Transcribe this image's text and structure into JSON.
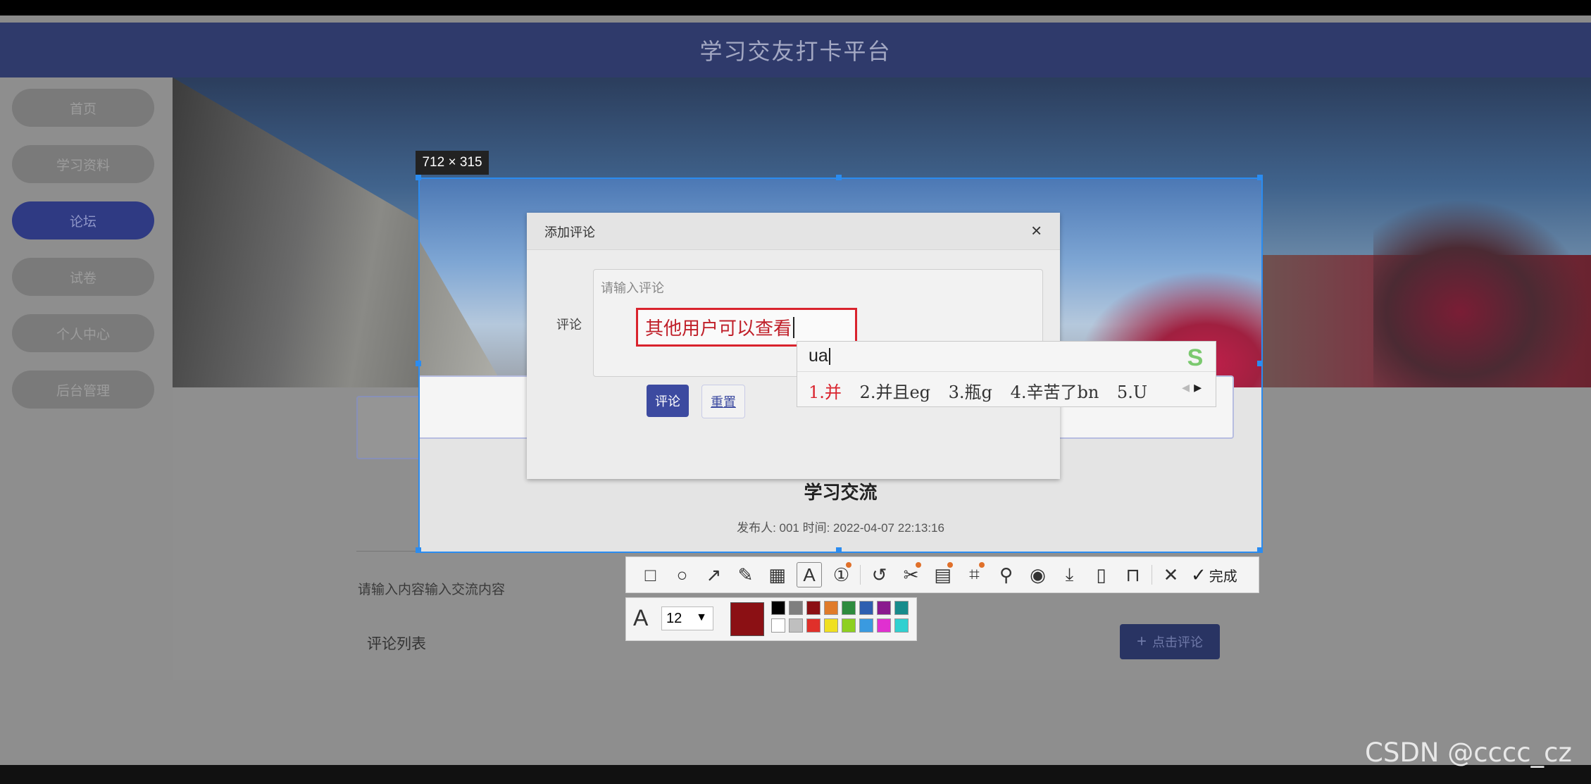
{
  "header": {
    "title": "学习交友打卡平台"
  },
  "sidebar": {
    "items": [
      {
        "label": "首页",
        "active": false
      },
      {
        "label": "学习资料",
        "active": false
      },
      {
        "label": "论坛",
        "active": true
      },
      {
        "label": "试卷",
        "active": false
      },
      {
        "label": "个人中心",
        "active": false
      },
      {
        "label": "后台管理",
        "active": false
      }
    ]
  },
  "post": {
    "title": "学习交流",
    "meta": "发布人: 001 时间: 2022-04-07 22:13:16",
    "content_placeholder": "请输入内容输入交流内容",
    "comments_title": "评论列表",
    "add_comment_label": "点击评论"
  },
  "capture": {
    "size_label": "712 × 315",
    "done_label": "完成"
  },
  "dialog": {
    "title": "添加评论",
    "close_glyph": "×",
    "field_label": "评论",
    "placeholder": "请输入评论",
    "typed_text": "其他用户可以查看",
    "submit_label": "评论",
    "reset_label": "重置"
  },
  "ime": {
    "composition": "ua",
    "candidates": [
      "1.并",
      "2.并且eg",
      "3.瓶g",
      "4.辛苦了bn",
      "5.U"
    ],
    "logo": "S"
  },
  "style_toolbar": {
    "font_size": "12",
    "current_color": "#8b1014",
    "palette": [
      "#000000",
      "#7f7f7f",
      "#8b1014",
      "#e07b2a",
      "#2e8b3e",
      "#2e5fb0",
      "#8a1a8e",
      "#178b8b",
      "#ffffff",
      "#bfbfbf",
      "#e0302a",
      "#f0e020",
      "#8ed020",
      "#3a9ae0",
      "#e030d0",
      "#30d0d0"
    ]
  },
  "watermark": "CSDN @cccc_cz"
}
